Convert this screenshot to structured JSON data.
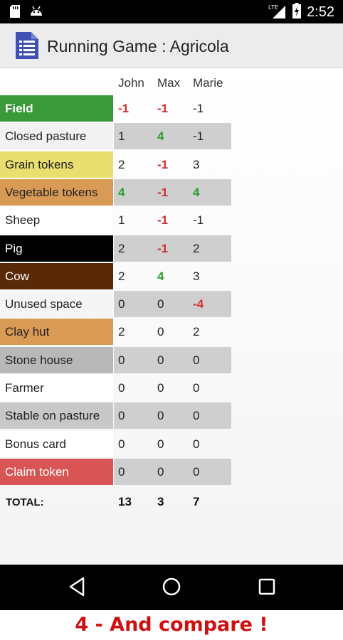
{
  "status_bar": {
    "network": "LTE",
    "time": "2:52"
  },
  "app_bar": {
    "title": "Running Game : Agricola"
  },
  "players": [
    "John",
    "Max",
    "Marie"
  ],
  "rows": [
    {
      "label": "Field",
      "label_bg": "#3a9a3a",
      "label_color": "#ffffff",
      "label_bold": true,
      "values": [
        "-1",
        "-1",
        "-1"
      ],
      "value_styles": [
        "neg",
        "neg",
        "plain"
      ]
    },
    {
      "label": "Closed pasture",
      "label_bg": "#f2f2f2",
      "label_color": "#222222",
      "values": [
        "1",
        "4",
        "-1"
      ],
      "value_styles": [
        "plain",
        "pos",
        "plain"
      ]
    },
    {
      "label": "Grain tokens",
      "label_bg": "#e8df6e",
      "label_color": "#222222",
      "values": [
        "2",
        "-1",
        "3"
      ],
      "value_styles": [
        "plain",
        "neg",
        "plain"
      ]
    },
    {
      "label": "Vegetable tokens",
      "label_bg": "#d89a55",
      "label_color": "#222222",
      "values": [
        "4",
        "-1",
        "4"
      ],
      "value_styles": [
        "pos",
        "neg",
        "pos"
      ]
    },
    {
      "label": "Sheep",
      "label_bg": "#ffffff",
      "label_color": "#222222",
      "values": [
        "1",
        "-1",
        "-1"
      ],
      "value_styles": [
        "plain",
        "neg",
        "plain"
      ]
    },
    {
      "label": "Pig",
      "label_bg": "#000000",
      "label_color": "#ffffff",
      "values": [
        "2",
        "-1",
        "2"
      ],
      "value_styles": [
        "plain",
        "neg",
        "plain"
      ]
    },
    {
      "label": "Cow",
      "label_bg": "#5a2a08",
      "label_color": "#ffffff",
      "values": [
        "2",
        "4",
        "3"
      ],
      "value_styles": [
        "plain",
        "pos",
        "plain"
      ]
    },
    {
      "label": "Unused space",
      "label_bg": "#f5f5f5",
      "label_color": "#222222",
      "values": [
        "0",
        "0",
        "-4"
      ],
      "value_styles": [
        "plain",
        "plain",
        "neg"
      ]
    },
    {
      "label": "Clay hut",
      "label_bg": "#d89a55",
      "label_color": "#222222",
      "values": [
        "2",
        "0",
        "2"
      ],
      "value_styles": [
        "plain",
        "plain",
        "plain"
      ]
    },
    {
      "label": "Stone house",
      "label_bg": "#b8b8b8",
      "label_color": "#222222",
      "values": [
        "0",
        "0",
        "0"
      ],
      "value_styles": [
        "plain",
        "plain",
        "plain"
      ]
    },
    {
      "label": "Farmer",
      "label_bg": "#ffffff",
      "label_color": "#222222",
      "values": [
        "0",
        "0",
        "0"
      ],
      "value_styles": [
        "plain",
        "plain",
        "plain"
      ]
    },
    {
      "label": "Stable on pasture",
      "label_bg": "#c8c8c8",
      "label_color": "#222222",
      "values": [
        "0",
        "0",
        "0"
      ],
      "value_styles": [
        "plain",
        "plain",
        "plain"
      ]
    },
    {
      "label": "Bonus card",
      "label_bg": "#ffffff",
      "label_color": "#222222",
      "values": [
        "0",
        "0",
        "0"
      ],
      "value_styles": [
        "plain",
        "plain",
        "plain"
      ]
    },
    {
      "label": "Claim token",
      "label_bg": "#d95555",
      "label_color": "#ffffff",
      "values": [
        "0",
        "0",
        "0"
      ],
      "value_styles": [
        "plain",
        "plain",
        "plain"
      ]
    }
  ],
  "totals": {
    "label": "TOTAL:",
    "values": [
      "13",
      "3",
      "7"
    ]
  },
  "nav_bar": {
    "back": "back-icon",
    "home": "home-icon",
    "recents": "recents-icon"
  },
  "caption": "4 - And compare !"
}
